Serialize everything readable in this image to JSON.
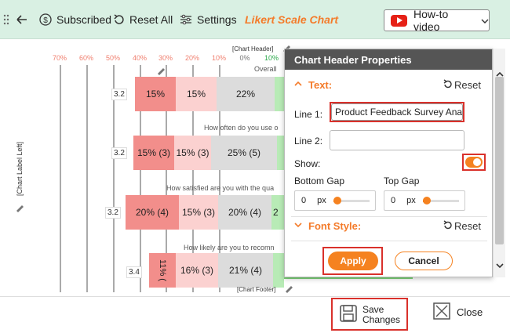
{
  "toolbar": {
    "subscribed": "Subscribed",
    "reset_all": "Reset All",
    "settings": "Settings",
    "brand": "Likert Scale Chart",
    "howto": "How-to video"
  },
  "chart": {
    "header_placeholder": "[Chart Header]",
    "footer_placeholder": "[Chart Footer]",
    "left_label_placeholder": "[Chart Label Left]",
    "ticks": [
      "70%",
      "60%",
      "50%",
      "40%",
      "30%",
      "20%",
      "10%",
      "0%",
      "10%"
    ],
    "rows": [
      {
        "question": "Overall",
        "score": "3.2",
        "segments": [
          "15%",
          "15%",
          "22%",
          ""
        ]
      },
      {
        "question": "How often do you use o",
        "score": "3.2",
        "segments": [
          "15% (3)",
          "15% (3)",
          "25% (5)",
          ""
        ]
      },
      {
        "question": "How satisfied are you with the qua",
        "score": "3.2",
        "segments": [
          "20% (4)",
          "15% (3)",
          "20% (4)",
          "2"
        ]
      },
      {
        "question": "How likely are you to recomn",
        "score": "3.4",
        "segments": [
          "11% (",
          "16% (3)",
          "21% (4)",
          ""
        ]
      }
    ]
  },
  "panel": {
    "title": "Chart Header Properties",
    "text_section": "Text:",
    "reset": "Reset",
    "line1_label": "Line 1:",
    "line1_value": "Product Feedback Survey Ana",
    "line2_label": "Line 2:",
    "line2_value": "",
    "show_label": "Show:",
    "show_on": true,
    "bottom_gap_label": "Bottom Gap",
    "bottom_gap_value": "0",
    "top_gap_label": "Top Gap",
    "top_gap_value": "0",
    "px": "px",
    "font_style_section": "Font Style:",
    "apply": "Apply",
    "cancel": "Cancel"
  },
  "footer": {
    "save_line1": "Save",
    "save_line2": "Changes",
    "close": "Close"
  },
  "colors": {
    "toolbar_bg": "#d9f0e3",
    "accent": "#f58220",
    "highlight": "#d9312b",
    "strongly_disagree": "#f28e8b",
    "disagree": "#fbd1d0",
    "neutral": "#dcdcdc",
    "agree": "#b8ebb6",
    "strongly_agree": "#7ed87b"
  }
}
